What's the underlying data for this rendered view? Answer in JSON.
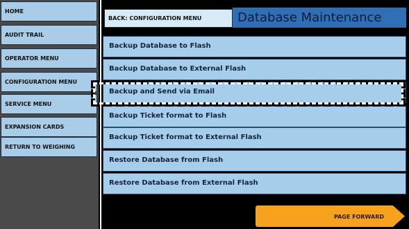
{
  "sidebar": {
    "items": [
      {
        "label": "HOME"
      },
      {
        "label": "AUDIT TRAIL"
      },
      {
        "label": "OPERATOR MENU"
      },
      {
        "label": "CONFIGURATION MENU"
      },
      {
        "label": "SERVICE MENU"
      },
      {
        "label": "EXPANSION CARDS"
      },
      {
        "label": "RETURN TO WEIGHING"
      }
    ]
  },
  "header": {
    "back_label": "BACK: CONFIGURATION MENU",
    "title": "Database Maintenance"
  },
  "menu": {
    "items": [
      {
        "label": "Backup Database to Flash"
      },
      {
        "label": "Backup Database to External Flash"
      },
      {
        "label": "Backup and Send via Email"
      },
      {
        "label": "Backup Ticket format to Flash"
      },
      {
        "label": "Backup Ticket format to External Flash"
      },
      {
        "label": "Restore Database from Flash"
      },
      {
        "label": "Restore Database from External Flash"
      }
    ]
  },
  "footer": {
    "page_forward_label": "PAGE FORWARD"
  },
  "colors": {
    "menu_bg": "#a6cdea",
    "title_bg": "#2e6fb5",
    "page_forward_bg": "#f7a21e",
    "sidebar_bg": "#4a4a4a"
  }
}
